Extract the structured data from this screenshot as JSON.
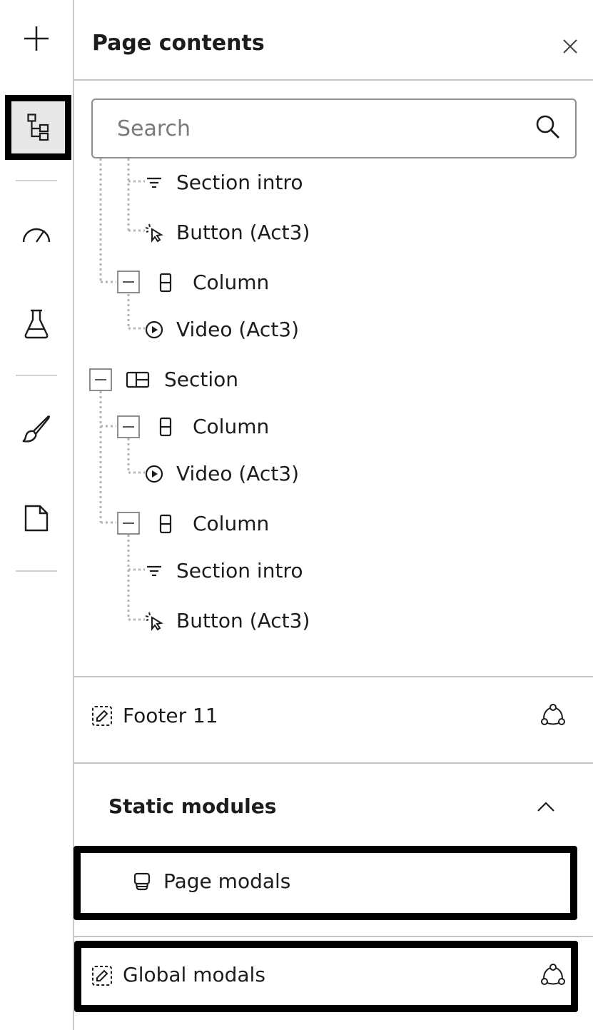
{
  "rail": {
    "icons": [
      "plus-icon",
      "tree-structure-icon",
      "gauge-icon",
      "flask-icon",
      "paintbrush-icon",
      "page-icon"
    ],
    "active_icon": "tree-structure-icon"
  },
  "panel": {
    "title": "Page contents",
    "close_icon": "close-icon"
  },
  "search": {
    "placeholder": "Search",
    "value": "",
    "icon": "search-icon"
  },
  "tree": [
    {
      "label": "Section intro",
      "icon": "text-align-icon"
    },
    {
      "label": "Button (Act3)",
      "icon": "cursor-click-icon"
    },
    {
      "label": "Column",
      "icon": "column-icon",
      "collapsible": true
    },
    {
      "label": "Video (Act3)",
      "icon": "play-circle-icon"
    },
    {
      "label": "Section",
      "icon": "section-layout-icon",
      "collapsible": true
    },
    {
      "label": "Column",
      "icon": "column-icon",
      "collapsible": true
    },
    {
      "label": "Video (Act3)",
      "icon": "play-circle-icon"
    },
    {
      "label": "Column",
      "icon": "column-icon",
      "collapsible": true
    },
    {
      "label": "Section intro",
      "icon": "text-align-icon"
    },
    {
      "label": "Button (Act3)",
      "icon": "cursor-click-icon"
    }
  ],
  "footer": {
    "label": "Footer 11",
    "icon": "global-module-icon",
    "action_icon": "share-nodes-icon"
  },
  "static_modules": {
    "title": "Static modules",
    "expanded_icon": "chevron-up-icon",
    "items": [
      {
        "label": "Page modals",
        "icon": "modal-icon"
      }
    ]
  },
  "global_modals": {
    "label": "Global modals",
    "icon": "global-module-icon",
    "action_icon": "share-nodes-icon"
  },
  "colors": {
    "text": "#1c1c1c",
    "divider": "#c4c4c4",
    "highlight_border": "#000000",
    "active_rail_bg": "#e8e8e8"
  }
}
